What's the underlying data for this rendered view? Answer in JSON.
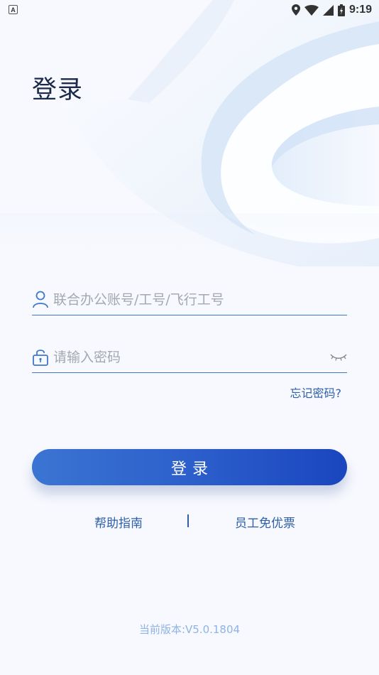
{
  "status_bar": {
    "left_icon_letter": "A",
    "time": "9:19",
    "icons": [
      "location-icon",
      "wifi-icon",
      "signal-icon",
      "battery-icon"
    ]
  },
  "page": {
    "title": "登录"
  },
  "form": {
    "account": {
      "placeholder": "联合办公账号/工号/飞行工号",
      "value": "",
      "icon": "user-icon"
    },
    "password": {
      "placeholder": "请输入密码",
      "value": "",
      "icon": "lock-icon",
      "toggle_icon": "eye-closed-icon"
    },
    "forgot_label": "忘记密码?",
    "login_label": "登录"
  },
  "links": {
    "help_label": "帮助指南",
    "separator": "|",
    "ticket_label": "员工免优票"
  },
  "version_text": "当前版本:V5.0.1804",
  "colors": {
    "accent": "#2e5fa8",
    "button_start": "#3b75d2",
    "button_end": "#1a46be",
    "background": "#f7f9fe",
    "version": "#8fb3e4"
  }
}
